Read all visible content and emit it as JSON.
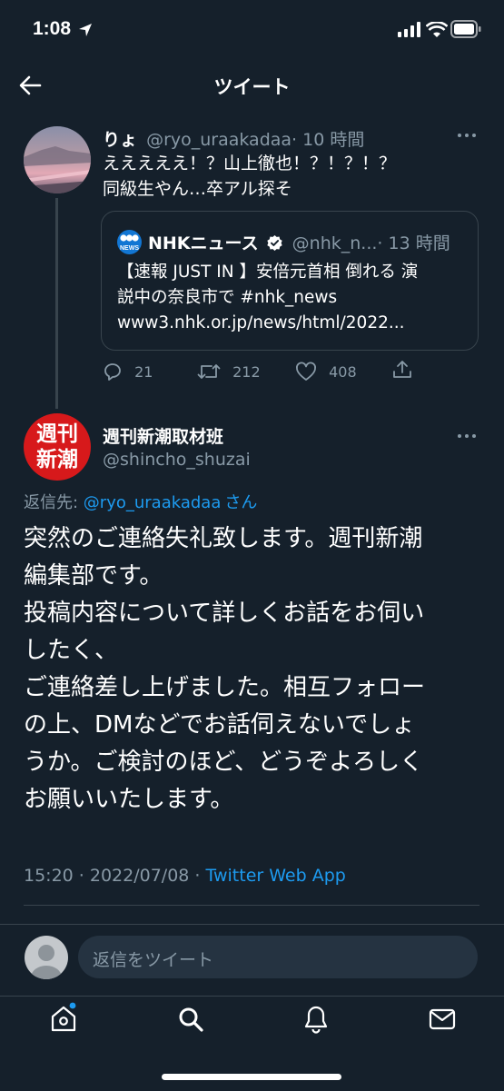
{
  "status_bar": {
    "time": "1:08"
  },
  "header": {
    "title": "ツイート"
  },
  "original_tweet": {
    "display_name": "りょ",
    "handle": "@ryo_uraakadaa",
    "time": "· 10 時間",
    "text_lines": [
      "えええええ！？山上徹也！？！？！？",
      "同級生やん…卒アル探そ"
    ],
    "quote": {
      "display_name": "NHKニュース",
      "handle": "@nhk_n...",
      "time": "· 13 時間",
      "text_lines": [
        "【速報 JUST IN 】安倍元首相 倒れる 演",
        "説中の奈良市で #nhk_news",
        "www3.nhk.or.jp/news/html/2022..."
      ]
    },
    "actions": {
      "replies": "21",
      "retweets": "212",
      "likes": "408"
    }
  },
  "reply_tweet": {
    "avatar_text_1": "週刊",
    "avatar_text_2": "新潮",
    "display_name": "週刊新潮取材班",
    "handle": "@shincho_shuzai",
    "replying_to_prefix": "返信先: ",
    "replying_to_handle": "@ryo_uraakadaa",
    "replying_to_suffix": "さん",
    "text": "突然のご連絡失礼致します。週刊新潮\n編集部です。\n投稿内容について詳しくお話をお伺い\nしたく、\nご連絡差し上げました。相互フォロー\nの上、DMなどでお話伺えないでしょ\nうか。ご検討のほど、どうぞよろしく\nお願いいたします。",
    "timestamp": "15:20 · 2022/07/08 · ",
    "source": "Twitter Web App"
  },
  "reply_bar": {
    "placeholder": "返信をツイート"
  },
  "colors": {
    "background": "#15202b",
    "accent": "#1d9bf0",
    "muted": "#8899a6",
    "avatar_red": "#d7191b"
  }
}
